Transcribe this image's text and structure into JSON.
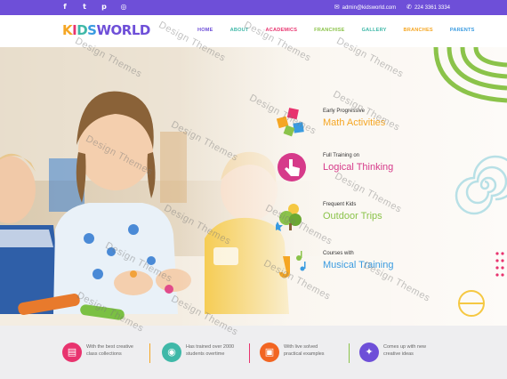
{
  "topbar": {
    "social_icons": [
      "facebook-icon",
      "twitter-icon",
      "pinterest-icon",
      "instagram-icon"
    ],
    "email": "admin@kidsworld.com",
    "phone": "224 3361 3334"
  },
  "logo": {
    "letters": [
      "K",
      "I",
      "D",
      "S",
      "W",
      "O",
      "R",
      "L",
      "D"
    ]
  },
  "menu": [
    {
      "label": "HOME",
      "color": "#6e4fd8"
    },
    {
      "label": "ABOUT",
      "color": "#3fb8a8"
    },
    {
      "label": "ACADEMICS",
      "color": "#e8336e"
    },
    {
      "label": "FRANCHISE",
      "color": "#8bc34a"
    },
    {
      "label": "GALLERY",
      "color": "#3fb8a8"
    },
    {
      "label": "BRANCHES",
      "color": "#f5a623"
    },
    {
      "label": "PARENTS",
      "color": "#3a9be0"
    }
  ],
  "features": [
    {
      "sub": "Early Progressive",
      "title": "Math Activities",
      "color": "#f5a623"
    },
    {
      "sub": "Full Training on",
      "title": "Logical Thinking",
      "color": "#d63a8a"
    },
    {
      "sub": "Frequent Kids",
      "title": "Outdoor Trips",
      "color": "#8bc34a"
    },
    {
      "sub": "Courses with",
      "title": "Musical Training",
      "color": "#3a9be0"
    }
  ],
  "bottom": [
    {
      "l1": "With the best creative",
      "l2": "class collections",
      "color": "#e8336e",
      "icon": "book-icon"
    },
    {
      "l1": "Has trained over 2000",
      "l2": "students overtime",
      "color": "#3fb8a8",
      "icon": "brain-icon"
    },
    {
      "l1": "With live solved",
      "l2": "practical examples",
      "color": "#f26522",
      "icon": "clipboard-icon"
    },
    {
      "l1": "Comes up with new",
      "l2": "creative ideas",
      "color": "#6e4fd8",
      "icon": "bulb-icon"
    }
  ],
  "watermark": "Design Themes",
  "colors": {
    "purple": "#6e4fd8",
    "green": "#8bc34a",
    "pink": "#e8336e",
    "teal": "#3fb8a8",
    "orange": "#f5a623",
    "blue": "#3a9be0"
  }
}
